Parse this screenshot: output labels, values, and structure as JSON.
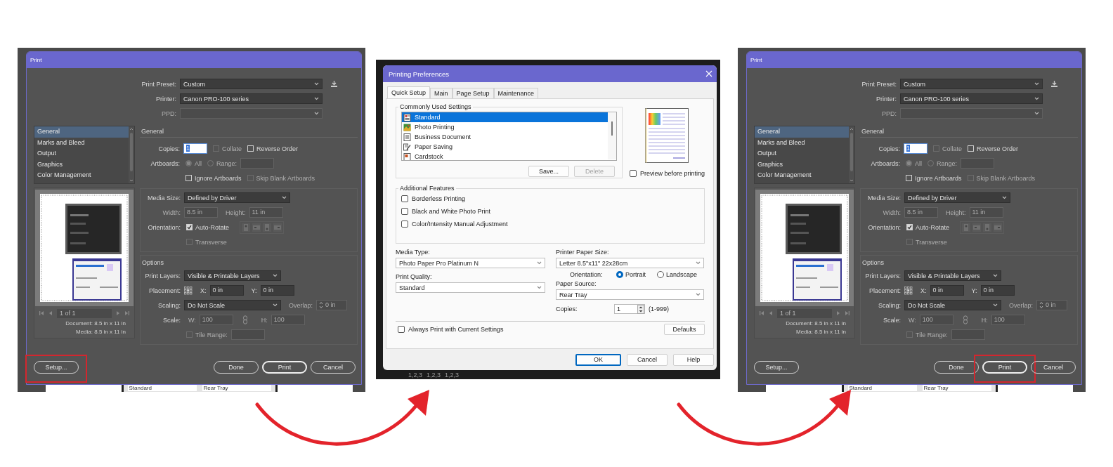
{
  "panels": [
    {
      "kind": "ai_print",
      "title": "Print",
      "top_rows": [
        {
          "label": "Print Preset:",
          "disabled": false,
          "items": [
            {
              "kind": "dropdown",
              "value": "Custom",
              "disabled": false
            },
            {
              "kind": "download_icon"
            }
          ]
        },
        {
          "label": "Printer:",
          "disabled": false,
          "items": [
            {
              "kind": "dropdown",
              "value": "Canon PRO-100 series",
              "disabled": false
            }
          ]
        },
        {
          "label": "PPD:",
          "disabled": true,
          "items": [
            {
              "kind": "dropdown",
              "disabled": true
            }
          ]
        }
      ],
      "categories": [
        {
          "label": "General",
          "selected": true
        },
        {
          "label": "Marks and Bleed",
          "selected": false
        },
        {
          "label": "Output",
          "selected": false
        },
        {
          "label": "Graphics",
          "selected": false
        },
        {
          "label": "Color Management",
          "selected": false
        }
      ],
      "pager": "1 of 1",
      "document_info": "Document: 8.5 in x 11 in",
      "media_info": "Media: 8.5 in x 11 in",
      "sections": [
        {
          "heading": "General",
          "boxed": false,
          "rows": [
            {
              "label": "Copies:",
              "disabled": false,
              "items": [
                {
                  "kind": "input",
                  "value": "1",
                  "focused": true,
                  "disabled": false
                },
                {
                  "kind": "checkbox",
                  "label": "Collate",
                  "checked": false,
                  "disabled": true
                },
                {
                  "kind": "checkbox",
                  "label": "Reverse Order",
                  "checked": false,
                  "disabled": false
                }
              ]
            },
            {
              "label": "Artboards:",
              "disabled": false,
              "items": [
                {
                  "kind": "radio",
                  "label": "All",
                  "selected": true,
                  "disabled": true
                },
                {
                  "kind": "radio",
                  "label": "Range:",
                  "selected": false,
                  "disabled": true
                },
                {
                  "kind": "input",
                  "focused": false,
                  "disabled": true
                }
              ]
            },
            {
              "items": [
                {
                  "kind": "checkbox",
                  "label": "Ignore Artboards",
                  "checked": false,
                  "disabled": false
                },
                {
                  "kind": "checkbox",
                  "label": "Skip Blank Artboards",
                  "checked": false,
                  "disabled": true
                }
              ]
            }
          ]
        },
        {
          "boxed": true,
          "rows": [
            {
              "label": "Media Size:",
              "disabled": false,
              "items": [
                {
                  "kind": "dropdown",
                  "value": "Defined by Driver",
                  "disabled": false
                }
              ]
            },
            {
              "label": "Width:",
              "disabled": true,
              "items": [
                {
                  "kind": "input",
                  "value": "8.5 in",
                  "focused": false,
                  "disabled": true
                },
                {
                  "kind": "text",
                  "text": "Height:",
                  "disabled": true
                },
                {
                  "kind": "input",
                  "value": "11 in",
                  "focused": false,
                  "disabled": true
                }
              ]
            },
            {
              "label": "Orientation:",
              "disabled": false,
              "items": [
                {
                  "kind": "checkbox",
                  "label": "Auto-Rotate",
                  "checked": true,
                  "disabled": false
                },
                {
                  "kind": "orientation_icons",
                  "disabled": true
                }
              ]
            },
            {
              "items": [
                {
                  "kind": "checkbox",
                  "label": "Transverse",
                  "checked": false,
                  "disabled": true
                }
              ]
            }
          ]
        },
        {
          "heading": "Options",
          "boxed": true,
          "rows": [
            {
              "label": "Print Layers:",
              "disabled": false,
              "items": [
                {
                  "kind": "dropdown",
                  "value": "Visible & Printable Layers",
                  "disabled": false
                }
              ]
            },
            {
              "label": "Placement:",
              "disabled": false,
              "items": [
                {
                  "kind": "placement_icon"
                },
                {
                  "kind": "text",
                  "text": "X:",
                  "disabled": false
                },
                {
                  "kind": "input",
                  "value": "0 in",
                  "focused": false,
                  "disabled": false
                },
                {
                  "kind": "text",
                  "text": "Y:",
                  "disabled": false
                },
                {
                  "kind": "input",
                  "value": "0 in",
                  "focused": false,
                  "disabled": false
                }
              ]
            },
            {
              "label": "Scaling:",
              "disabled": false,
              "items": [
                {
                  "kind": "dropdown",
                  "value": "Do Not Scale",
                  "disabled": false
                },
                {
                  "kind": "text",
                  "text": "Overlap:",
                  "disabled": true
                },
                {
                  "kind": "spinner",
                  "value": "0 in",
                  "disabled": true
                }
              ]
            },
            {
              "label": "Scale:",
              "disabled": false,
              "items": [
                {
                  "kind": "text",
                  "text": "W:",
                  "disabled": true
                },
                {
                  "kind": "input",
                  "value": "100",
                  "focused": false,
                  "disabled": true
                },
                {
                  "kind": "link_icon"
                },
                {
                  "kind": "text",
                  "text": "H:",
                  "disabled": true
                },
                {
                  "kind": "input",
                  "value": "100",
                  "focused": false,
                  "disabled": true
                }
              ]
            },
            {
              "items": [
                {
                  "kind": "checkbox",
                  "label": "Tile Range:",
                  "checked": false,
                  "disabled": true
                },
                {
                  "kind": "input",
                  "focused": false,
                  "disabled": true
                }
              ]
            }
          ]
        }
      ],
      "buttons": [
        {
          "label": "Setup...",
          "highlighted": true,
          "default": false
        },
        {
          "label": "Done",
          "highlighted": false,
          "default": false
        },
        {
          "label": "Print",
          "highlighted": false,
          "default": true
        },
        {
          "label": "Cancel",
          "highlighted": false,
          "default": false
        }
      ],
      "backdrop_text": [
        "Standard",
        "Rear Tray"
      ]
    },
    {
      "kind": "printing_preferences",
      "title": "Printing Preferences",
      "tabs": [
        {
          "label": "Quick Setup",
          "selected": true
        },
        {
          "label": "Main",
          "selected": false
        },
        {
          "label": "Page Setup",
          "selected": false
        },
        {
          "label": "Maintenance",
          "selected": false
        }
      ],
      "settings_group": {
        "title": "Commonly Used Settings",
        "items": [
          {
            "label": "Standard",
            "selected": true
          },
          {
            "label": "Photo Printing",
            "selected": false
          },
          {
            "label": "Business Document",
            "selected": false
          },
          {
            "label": "Paper Saving",
            "selected": false
          },
          {
            "label": "Cardstock",
            "selected": false
          }
        ],
        "buttons": [
          {
            "label": "Save...",
            "disabled": false
          },
          {
            "label": "Delete",
            "disabled": true
          }
        ]
      },
      "preview_checkbox": {
        "label": "Preview before printing",
        "checked": false
      },
      "features_group": {
        "title": "Additional Features",
        "items": [
          {
            "label": "Borderless Printing",
            "checked": false
          },
          {
            "label": "Black and White Photo Print",
            "checked": false
          },
          {
            "label": "Color/Intensity Manual Adjustment",
            "checked": false
          }
        ]
      },
      "left_fields": [
        {
          "label": "Media Type:",
          "value": "Photo Paper Pro Platinum N"
        },
        {
          "label": "Print Quality:",
          "value": "Standard"
        }
      ],
      "right_fields": [
        {
          "label": "Printer Paper Size:",
          "value": "Letter 8.5\"x11\" 22x28cm"
        },
        {
          "label": "Paper Source:",
          "value": "Rear Tray"
        }
      ],
      "orientation": {
        "label": "Orientation:",
        "options": [
          {
            "label": "Portrait",
            "selected": true
          },
          {
            "label": "Landscape",
            "selected": false
          }
        ]
      },
      "copies": {
        "label": "Copies:",
        "value": "1",
        "range": "(1-999)"
      },
      "always_print": {
        "label": "Always Print with Current Settings",
        "checked": false
      },
      "defaults_button": "Defaults",
      "footer_buttons": [
        {
          "label": "OK",
          "focused": true
        },
        {
          "label": "Cancel",
          "focused": false
        },
        {
          "label": "Help",
          "focused": false
        }
      ],
      "backdrop_text": [
        "1,2,3",
        "1,2,3",
        "1,2,3"
      ]
    },
    {
      "kind": "ai_print",
      "title": "Print",
      "top_rows": [
        {
          "label": "Print Preset:",
          "disabled": false,
          "items": [
            {
              "kind": "dropdown",
              "value": "Custom",
              "disabled": false
            },
            {
              "kind": "download_icon"
            }
          ]
        },
        {
          "label": "Printer:",
          "disabled": false,
          "items": [
            {
              "kind": "dropdown",
              "value": "Canon PRO-100 series",
              "disabled": false
            }
          ]
        },
        {
          "label": "PPD:",
          "disabled": true,
          "items": [
            {
              "kind": "dropdown",
              "disabled": true
            }
          ]
        }
      ],
      "categories": [
        {
          "label": "General",
          "selected": true
        },
        {
          "label": "Marks and Bleed",
          "selected": false
        },
        {
          "label": "Output",
          "selected": false
        },
        {
          "label": "Graphics",
          "selected": false
        },
        {
          "label": "Color Management",
          "selected": false
        }
      ],
      "pager": "1 of 1",
      "document_info": "Document: 8.5 in x 11 in",
      "media_info": "Media: 8.5 in x 11 in",
      "sections": [
        {
          "heading": "General",
          "boxed": false,
          "rows": [
            {
              "label": "Copies:",
              "disabled": false,
              "items": [
                {
                  "kind": "input",
                  "value": "1",
                  "focused": true,
                  "disabled": false
                },
                {
                  "kind": "checkbox",
                  "label": "Collate",
                  "checked": false,
                  "disabled": true
                },
                {
                  "kind": "checkbox",
                  "label": "Reverse Order",
                  "checked": false,
                  "disabled": false
                }
              ]
            },
            {
              "label": "Artboards:",
              "disabled": false,
              "items": [
                {
                  "kind": "radio",
                  "label": "All",
                  "selected": true,
                  "disabled": true
                },
                {
                  "kind": "radio",
                  "label": "Range:",
                  "selected": false,
                  "disabled": true
                },
                {
                  "kind": "input",
                  "focused": false,
                  "disabled": true
                }
              ]
            },
            {
              "items": [
                {
                  "kind": "checkbox",
                  "label": "Ignore Artboards",
                  "checked": false,
                  "disabled": false
                },
                {
                  "kind": "checkbox",
                  "label": "Skip Blank Artboards",
                  "checked": false,
                  "disabled": true
                }
              ]
            }
          ]
        },
        {
          "boxed": true,
          "rows": [
            {
              "label": "Media Size:",
              "disabled": false,
              "items": [
                {
                  "kind": "dropdown",
                  "value": "Defined by Driver",
                  "disabled": false
                }
              ]
            },
            {
              "label": "Width:",
              "disabled": true,
              "items": [
                {
                  "kind": "input",
                  "value": "8.5 in",
                  "focused": false,
                  "disabled": true
                },
                {
                  "kind": "text",
                  "text": "Height:",
                  "disabled": true
                },
                {
                  "kind": "input",
                  "value": "11 in",
                  "focused": false,
                  "disabled": true
                }
              ]
            },
            {
              "label": "Orientation:",
              "disabled": false,
              "items": [
                {
                  "kind": "checkbox",
                  "label": "Auto-Rotate",
                  "checked": true,
                  "disabled": false
                },
                {
                  "kind": "orientation_icons",
                  "disabled": true
                }
              ]
            },
            {
              "items": [
                {
                  "kind": "checkbox",
                  "label": "Transverse",
                  "checked": false,
                  "disabled": true
                }
              ]
            }
          ]
        },
        {
          "heading": "Options",
          "boxed": true,
          "rows": [
            {
              "label": "Print Layers:",
              "disabled": false,
              "items": [
                {
                  "kind": "dropdown",
                  "value": "Visible & Printable Layers",
                  "disabled": false
                }
              ]
            },
            {
              "label": "Placement:",
              "disabled": false,
              "items": [
                {
                  "kind": "placement_icon"
                },
                {
                  "kind": "text",
                  "text": "X:",
                  "disabled": false
                },
                {
                  "kind": "input",
                  "value": "0 in",
                  "focused": false,
                  "disabled": false
                },
                {
                  "kind": "text",
                  "text": "Y:",
                  "disabled": false
                },
                {
                  "kind": "input",
                  "value": "0 in",
                  "focused": false,
                  "disabled": false
                }
              ]
            },
            {
              "label": "Scaling:",
              "disabled": false,
              "items": [
                {
                  "kind": "dropdown",
                  "value": "Do Not Scale",
                  "disabled": false
                },
                {
                  "kind": "text",
                  "text": "Overlap:",
                  "disabled": true
                },
                {
                  "kind": "spinner",
                  "value": "0 in",
                  "disabled": true
                }
              ]
            },
            {
              "label": "Scale:",
              "disabled": false,
              "items": [
                {
                  "kind": "text",
                  "text": "W:",
                  "disabled": true
                },
                {
                  "kind": "input",
                  "value": "100",
                  "focused": false,
                  "disabled": true
                },
                {
                  "kind": "link_icon"
                },
                {
                  "kind": "text",
                  "text": "H:",
                  "disabled": true
                },
                {
                  "kind": "input",
                  "value": "100",
                  "focused": false,
                  "disabled": true
                }
              ]
            },
            {
              "items": [
                {
                  "kind": "checkbox",
                  "label": "Tile Range:",
                  "checked": false,
                  "disabled": true
                },
                {
                  "kind": "input",
                  "focused": false,
                  "disabled": true
                }
              ]
            }
          ]
        }
      ],
      "buttons": [
        {
          "label": "Setup...",
          "highlighted": false,
          "default": false
        },
        {
          "label": "Done",
          "highlighted": false,
          "default": false
        },
        {
          "label": "Print",
          "highlighted": true,
          "default": true
        },
        {
          "label": "Cancel",
          "highlighted": false,
          "default": false
        }
      ],
      "backdrop_text": [
        "Standard",
        "Rear Tray"
      ]
    }
  ]
}
